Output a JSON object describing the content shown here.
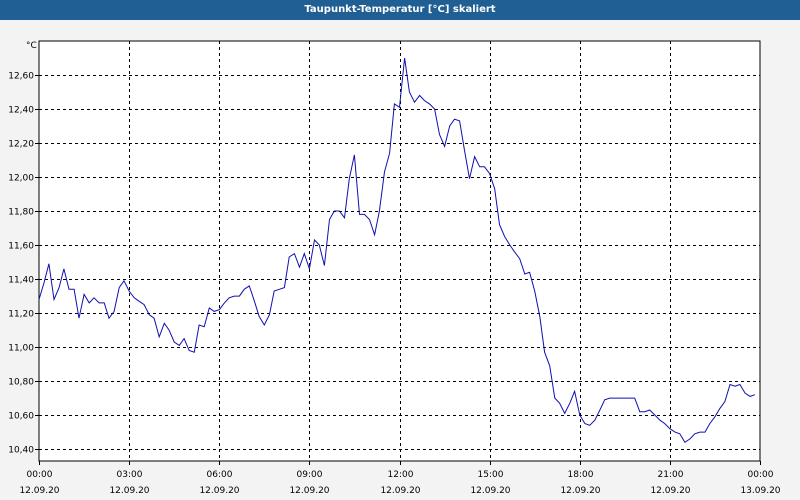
{
  "window": {
    "title": "Taupunkt-Temperatur [°C] skaliert"
  },
  "chart_data": {
    "type": "line",
    "title": "Taupunkt-Temperatur [°C] skaliert",
    "ylabel": "°C",
    "xlabel": "",
    "ylim": [
      10.33,
      12.8
    ],
    "xlim": [
      0,
      24
    ],
    "grid": true,
    "y_ticks": [
      10.4,
      10.6,
      10.8,
      11.0,
      11.2,
      11.4,
      11.6,
      11.8,
      12.0,
      12.2,
      12.4,
      12.6
    ],
    "y_tick_labels": [
      "10,40",
      "10,60",
      "10,80",
      "11,00",
      "11,20",
      "11,40",
      "11,60",
      "11,80",
      "12,00",
      "12,20",
      "12,40",
      "12,60"
    ],
    "x_ticks": [
      0,
      3,
      6,
      9,
      12,
      15,
      18,
      21,
      24
    ],
    "x_tick_times": [
      "00:00",
      "03:00",
      "06:00",
      "09:00",
      "12:00",
      "15:00",
      "18:00",
      "21:00",
      "00:00"
    ],
    "x_tick_dates": [
      "12.09.20",
      "12.09.20",
      "12.09.20",
      "12.09.20",
      "12.09.20",
      "12.09.20",
      "12.09.20",
      "12.09.20",
      "13.09.20"
    ],
    "series": [
      {
        "color": "#1010b0",
        "x": [
          0,
          0.17,
          0.33,
          0.5,
          0.67,
          0.83,
          1.0,
          1.17,
          1.33,
          1.5,
          1.67,
          1.83,
          2.0,
          2.17,
          2.33,
          2.5,
          2.67,
          2.83,
          3.0,
          3.17,
          3.33,
          3.5,
          3.67,
          3.83,
          4.0,
          4.17,
          4.33,
          4.5,
          4.67,
          4.83,
          5.0,
          5.17,
          5.33,
          5.5,
          5.67,
          5.83,
          6.0,
          6.17,
          6.33,
          6.5,
          6.67,
          6.83,
          7.0,
          7.17,
          7.33,
          7.5,
          7.67,
          7.83,
          8.0,
          8.17,
          8.33,
          8.5,
          8.67,
          8.83,
          9.0,
          9.17,
          9.33,
          9.5,
          9.67,
          9.83,
          10.0,
          10.17,
          10.33,
          10.5,
          10.67,
          10.83,
          11.0,
          11.17,
          11.33,
          11.5,
          11.67,
          11.83,
          12.0,
          12.17,
          12.33,
          12.5,
          12.67,
          12.83,
          13.0,
          13.17,
          13.33,
          13.5,
          13.67,
          13.83,
          14.0,
          14.17,
          14.33,
          14.5,
          14.67,
          14.83,
          15.0,
          15.17,
          15.33,
          15.5,
          15.67,
          15.83,
          16.0,
          16.17,
          16.33,
          16.5,
          16.67,
          16.83,
          17.0,
          17.17,
          17.33,
          17.5,
          17.67,
          17.83,
          18.0,
          18.17,
          18.33,
          18.5,
          18.67,
          18.83,
          19.0,
          19.17,
          19.33,
          19.5,
          19.67,
          19.83,
          20.0,
          20.17,
          20.33,
          20.5,
          20.67,
          20.83,
          21.0,
          21.17,
          21.33,
          21.5,
          21.67,
          21.83,
          22.0,
          22.17,
          22.33,
          22.5,
          22.67,
          22.83,
          23.0,
          23.17,
          23.33,
          23.5,
          23.67,
          23.83
        ],
        "values": [
          11.28,
          11.38,
          11.49,
          11.28,
          11.35,
          11.46,
          11.34,
          11.34,
          11.17,
          11.31,
          11.26,
          11.29,
          11.26,
          11.26,
          11.17,
          11.21,
          11.35,
          11.39,
          11.33,
          11.29,
          11.27,
          11.25,
          11.19,
          11.17,
          11.06,
          11.14,
          11.1,
          11.03,
          11.01,
          11.05,
          10.98,
          10.97,
          11.13,
          11.12,
          11.23,
          11.21,
          11.22,
          11.26,
          11.29,
          11.3,
          11.3,
          11.34,
          11.36,
          11.27,
          11.18,
          11.13,
          11.19,
          11.33,
          11.34,
          11.35,
          11.53,
          11.55,
          11.47,
          11.55,
          11.46,
          11.63,
          11.6,
          11.48,
          11.75,
          11.8,
          11.8,
          11.76,
          11.99,
          12.13,
          11.78,
          11.78,
          11.75,
          11.66,
          11.8,
          12.03,
          12.14,
          12.43,
          12.41,
          12.7,
          12.5,
          12.44,
          12.48,
          12.45,
          12.43,
          12.4,
          12.25,
          12.18,
          12.3,
          12.34,
          12.33,
          12.15,
          11.99,
          12.12,
          12.06,
          12.06,
          12.02,
          11.93,
          11.72,
          11.65,
          11.6,
          11.56,
          11.52,
          11.43,
          11.44,
          11.33,
          11.18,
          10.97,
          10.89,
          10.7,
          10.67,
          10.61,
          10.67,
          10.74,
          10.6,
          10.55,
          10.54,
          10.57,
          10.63,
          10.69,
          10.7,
          10.7,
          10.7,
          10.7,
          10.7,
          10.7,
          10.62,
          10.62,
          10.63,
          10.6,
          10.57,
          10.55,
          10.52,
          10.5,
          10.49,
          10.44,
          10.46,
          10.49,
          10.5,
          10.5,
          10.55,
          10.59,
          10.64,
          10.68,
          10.78,
          10.77,
          10.78,
          10.73,
          10.71,
          10.72
        ]
      }
    ]
  }
}
